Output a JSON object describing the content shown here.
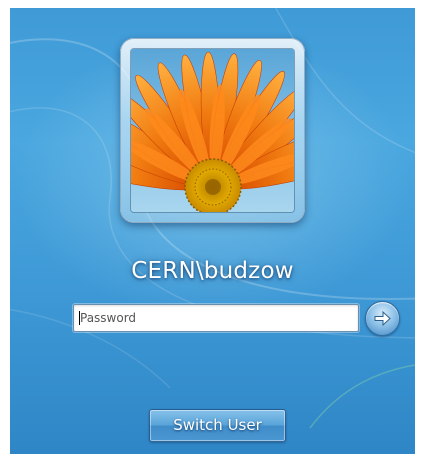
{
  "user": {
    "name": "CERN\\budzow"
  },
  "login": {
    "password_placeholder": "Password",
    "submit_icon": "arrow-right-icon"
  },
  "actions": {
    "switch_user_label": "Switch User"
  },
  "theme": {
    "background": "#3f9ad6",
    "button": "#4a97d1",
    "text": "#ffffff"
  }
}
